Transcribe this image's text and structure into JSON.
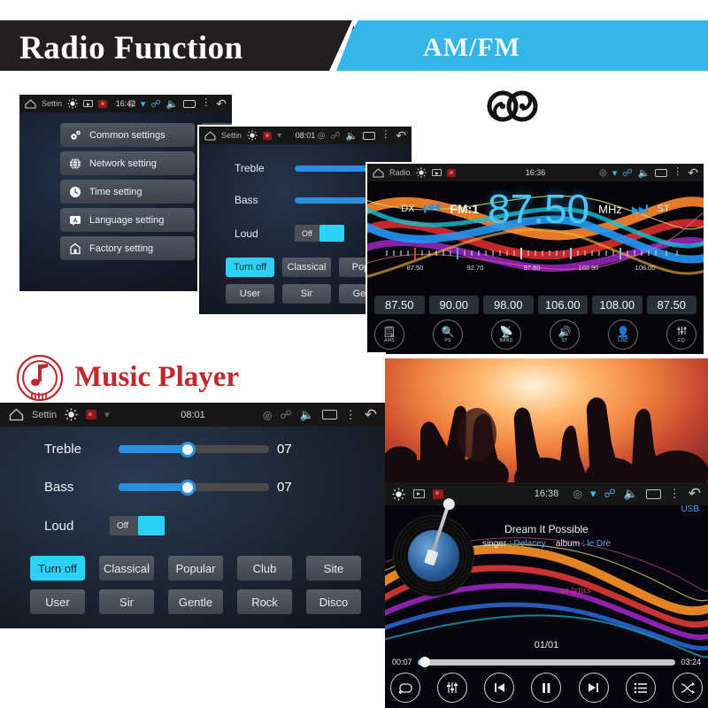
{
  "banner": {
    "title": "Radio Function",
    "subtitle": "AM/FM",
    "dark_color": "#231f20",
    "accent_color": "#35b5e8"
  },
  "logo": {
    "name": "double-spiral-logo"
  },
  "settings_panel": {
    "statusbar": {
      "app_label": "Settin",
      "time": "16:42",
      "icons": [
        "home-icon",
        "brightness-icon",
        "play-icon",
        "record-icon",
        "gps-icon",
        "wifi-icon",
        "bluetooth-icon",
        "volume-icon",
        "recents-icon",
        "more-icon",
        "back-icon"
      ]
    },
    "items": [
      {
        "label": "Common settings",
        "icon": "gears-icon"
      },
      {
        "label": "Network setting",
        "icon": "globe-icon"
      },
      {
        "label": "Time setting",
        "icon": "clock-icon"
      },
      {
        "label": "Language setting",
        "icon": "language-icon"
      },
      {
        "label": "Factory setting",
        "icon": "factory-icon"
      }
    ]
  },
  "eq_small_panel": {
    "statusbar": {
      "app_label": "Settin",
      "time": "08:01"
    },
    "treble": {
      "label": "Treble",
      "value_pct": 100
    },
    "bass": {
      "label": "Bass",
      "value_pct": 100
    },
    "loud": {
      "label": "Loud",
      "state": "Off"
    },
    "presets_row1": [
      "Turn off",
      "Classical",
      "Popu"
    ],
    "presets_row2": [
      "User",
      "Sir",
      "Gent"
    ],
    "active_preset": "Turn off"
  },
  "radio_panel": {
    "statusbar": {
      "app_label": "Radio",
      "time": "16:36"
    },
    "dx_label": "DX",
    "st_label": "ST",
    "band": "FM:1",
    "frequency": "87.50",
    "unit": "MHz",
    "prev_icon": "previous-station-icon",
    "next_icon": "next-station-icon",
    "scale_ticks": [
      "87.50",
      "92.70",
      "97.80",
      "102.90",
      "108.00"
    ],
    "presets": [
      "87.50",
      "90.00",
      "98.00",
      "106.00",
      "108.00",
      "87.50"
    ],
    "functions": [
      {
        "label": "AMS",
        "glyph": "▤"
      },
      {
        "label": "PS",
        "glyph": "⌕"
      },
      {
        "label": "BAND",
        "glyph": "▲"
      },
      {
        "label": "ST",
        "glyph": "◀"
      },
      {
        "label": "LOC",
        "glyph": "◎"
      },
      {
        "label": "EQ",
        "glyph": "≡"
      }
    ]
  },
  "music_header": {
    "title": "Music Player",
    "logo": "music-note-circle-icon",
    "color": "#c0282d"
  },
  "eq_big_panel": {
    "statusbar": {
      "app_label": "Settin",
      "time": "08:01"
    },
    "treble": {
      "label": "Treble",
      "value": "07",
      "value_pct": 46
    },
    "bass": {
      "label": "Bass",
      "value": "07",
      "value_pct": 46
    },
    "loud": {
      "label": "Loud",
      "state": "Off"
    },
    "presets_row1": [
      "Turn off",
      "Classical",
      "Popular",
      "Club",
      "Site"
    ],
    "presets_row2": [
      "User",
      "Sir",
      "Gentle",
      "Rock",
      "Disco"
    ],
    "active_preset": "Turn off"
  },
  "concert_image": {
    "name": "concert-crowd-photo"
  },
  "music_panel": {
    "statusbar": {
      "time": "16:38"
    },
    "source": "USB",
    "song_title": "Dream It Possible",
    "singer_key": "singer :",
    "singer_value": "Delacey",
    "album_key": "album :",
    "album_value": "le   Dre",
    "lyrics_status": "no lyrics",
    "track_index": "01/01",
    "elapsed": "00:07",
    "duration": "03:24",
    "progress_pct": 3,
    "controls": [
      {
        "name": "repeat-button",
        "glyph": "↻"
      },
      {
        "name": "equalizer-button",
        "glyph": "≡"
      },
      {
        "name": "previous-button",
        "glyph": "⏮"
      },
      {
        "name": "pause-button",
        "glyph": "⏸"
      },
      {
        "name": "next-button",
        "glyph": "⏭"
      },
      {
        "name": "playlist-button",
        "glyph": "☰"
      },
      {
        "name": "shuffle-button",
        "glyph": "⤨"
      }
    ]
  }
}
